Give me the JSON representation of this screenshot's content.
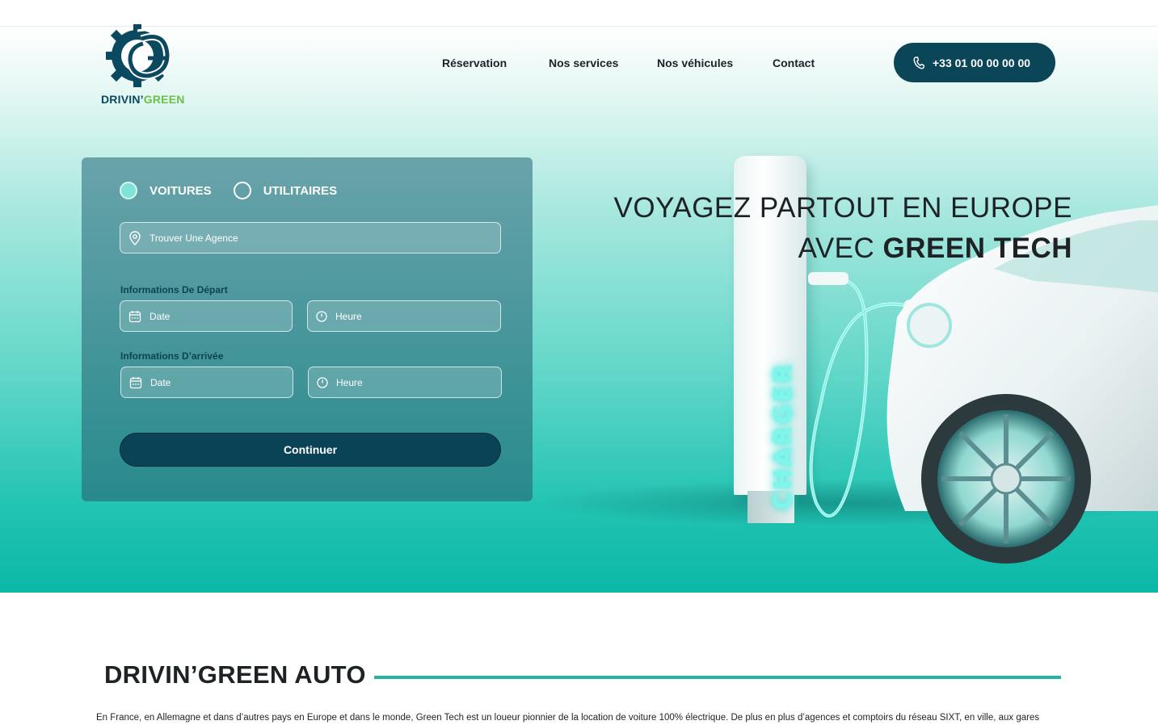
{
  "brand": {
    "name_part1": "DRIVIN’",
    "name_part2": "GREEN",
    "colors": {
      "primary": "#0a4558",
      "accent": "#6cc04a",
      "teal": "#22b3aa"
    }
  },
  "nav": {
    "items": [
      "Réservation",
      "Nos services",
      "Nos véhicules",
      "Contact"
    ],
    "phone": "+33 01 00 00 00 00"
  },
  "hero": {
    "headline_line1": "VOYAGEZ PARTOUT EN EUROPE",
    "headline_line2_prefix": "AVEC ",
    "headline_line2_bold": "GREEN TECH",
    "charger_label": "CHARGER"
  },
  "booking": {
    "vehicle_types": [
      {
        "label": "VOITURES",
        "selected": true
      },
      {
        "label": "UTILITAIRES",
        "selected": false
      }
    ],
    "agency_placeholder": "Trouver Une Agence",
    "departure_label": "Informations De Départ",
    "arrival_label": "Informations D’arrivée",
    "date_placeholder": "Date",
    "time_placeholder": "Heure",
    "continue_label": "Continuer"
  },
  "about": {
    "title": "DRIVIN’GREEN AUTO",
    "text": "En France, en Allemagne et dans d’autres pays en Europe et dans le monde, Green Tech est un loueur pionnier de la location de voiture 100% électrique. De plus en plus d’agences et comptoirs du réseau SIXT, en ville, aux gares"
  }
}
